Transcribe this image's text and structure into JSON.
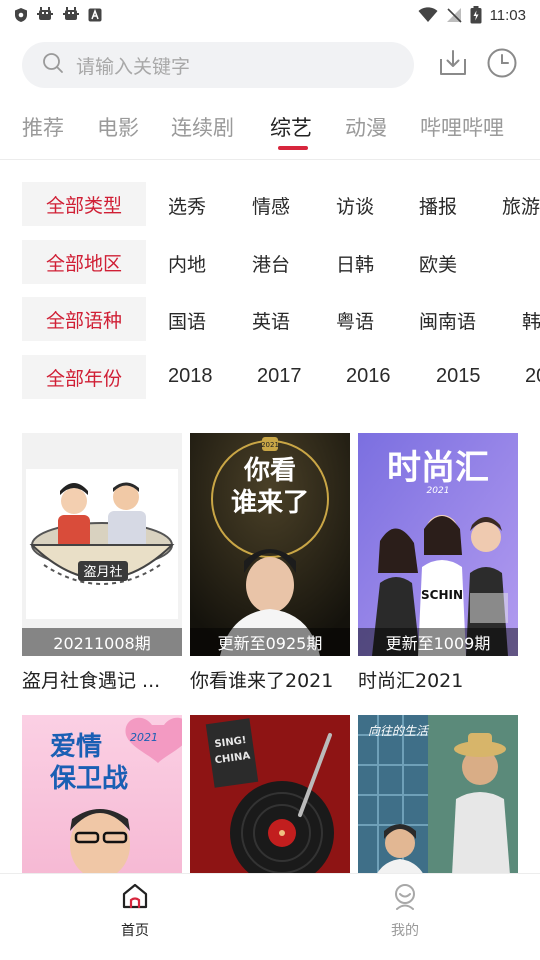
{
  "status_bar": {
    "time": "11:03"
  },
  "search": {
    "placeholder": "请输入关键字"
  },
  "tabs": [
    {
      "label": "推荐"
    },
    {
      "label": "电影"
    },
    {
      "label": "连续剧"
    },
    {
      "label": "综艺",
      "active": true
    },
    {
      "label": "动漫"
    },
    {
      "label": "哔哩哔哩"
    }
  ],
  "filters": [
    {
      "key": "全部类型",
      "options": [
        "选秀",
        "情感",
        "访谈",
        "播报",
        "旅游"
      ]
    },
    {
      "key": "全部地区",
      "options": [
        "内地",
        "港台",
        "日韩",
        "欧美"
      ]
    },
    {
      "key": "全部语种",
      "options": [
        "国语",
        "英语",
        "粤语",
        "闽南语",
        "韩"
      ]
    },
    {
      "key": "全部年份",
      "options": [
        "2018",
        "2017",
        "2016",
        "2015",
        "20"
      ]
    }
  ],
  "cards": [
    {
      "title": "盗月社食遇记 ...",
      "badge": "20211008期",
      "poster_text": "盗月社"
    },
    {
      "title": "你看谁来了2021",
      "badge": "更新至0925期",
      "poster_text": "你看\n谁来了",
      "poster_year": "2021"
    },
    {
      "title": "时尚汇2021",
      "badge": "更新至1009期",
      "poster_text": "时尚汇",
      "poster_year": "2021"
    }
  ],
  "cards_row2": [
    {
      "poster_text": "爱情保卫战",
      "poster_year": "2021"
    },
    {
      "poster_text": "SING! CHINA"
    },
    {
      "poster_text": "向往的生活"
    }
  ],
  "bottom_nav": [
    {
      "label": "首页",
      "icon": "home-icon",
      "active": true
    },
    {
      "label": "我的",
      "icon": "profile-icon",
      "active": false
    }
  ],
  "colors": {
    "accent": "#d7263d",
    "filter_key_text": "#d01f35",
    "tab_inactive": "#9a9a9a"
  }
}
